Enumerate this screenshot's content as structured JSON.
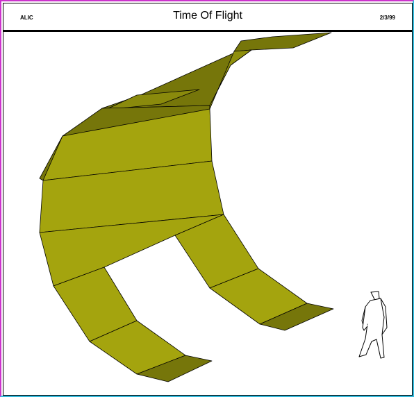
{
  "header": {
    "left_label": "ALIC",
    "title": "Time Of Flight",
    "date": "2/3/99"
  },
  "colors": {
    "face_light": "#a4a40e",
    "face_mid": "#8f8f0c",
    "face_dark": "#76760a",
    "edge": "#000000",
    "frame_left_top": "#cc33cc",
    "frame_right_bottom": "#33bbdd"
  },
  "figure_icons": [
    "tof-barrel-shape",
    "human-scale-figure"
  ]
}
